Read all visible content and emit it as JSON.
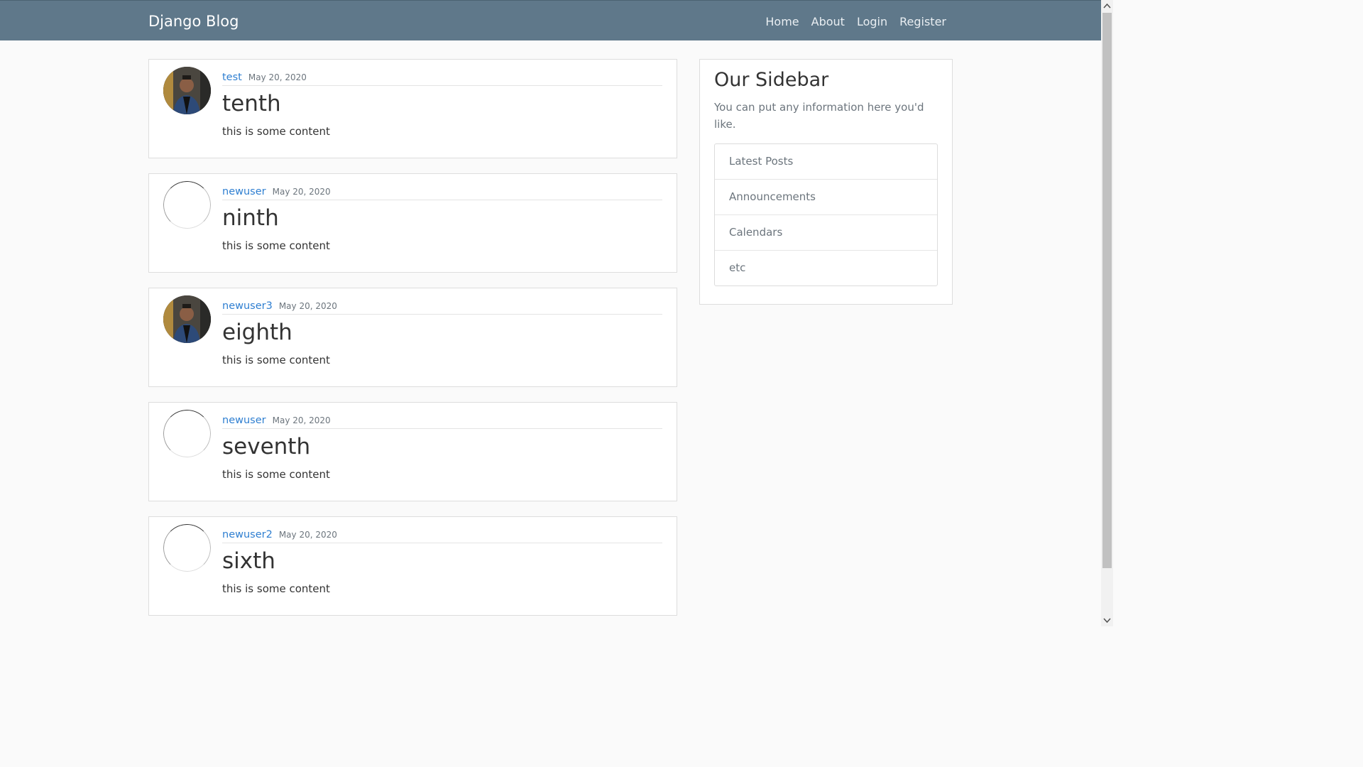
{
  "navbar": {
    "brand": "Django Blog",
    "links": [
      "Home",
      "About",
      "Login",
      "Register"
    ]
  },
  "posts": [
    {
      "author": "test",
      "date": "May 20, 2020",
      "title": "tenth",
      "content": "this is some content",
      "avatar": "photo"
    },
    {
      "author": "newuser",
      "date": "May 20, 2020",
      "title": "ninth",
      "content": "this is some content",
      "avatar": "broken"
    },
    {
      "author": "newuser3",
      "date": "May 20, 2020",
      "title": "eighth",
      "content": "this is some content",
      "avatar": "photo"
    },
    {
      "author": "newuser",
      "date": "May 20, 2020",
      "title": "seventh",
      "content": "this is some content",
      "avatar": "broken"
    },
    {
      "author": "newuser2",
      "date": "May 20, 2020",
      "title": "sixth",
      "content": "this is some content",
      "avatar": "broken"
    }
  ],
  "sidebar": {
    "title": "Our Sidebar",
    "text": "You can put any information here you'd like.",
    "items": [
      "Latest Posts",
      "Announcements",
      "Calendars",
      "etc"
    ]
  },
  "colors": {
    "navbar": "#5f788a",
    "link": "#2f7fd1",
    "background": "#fafafa"
  }
}
